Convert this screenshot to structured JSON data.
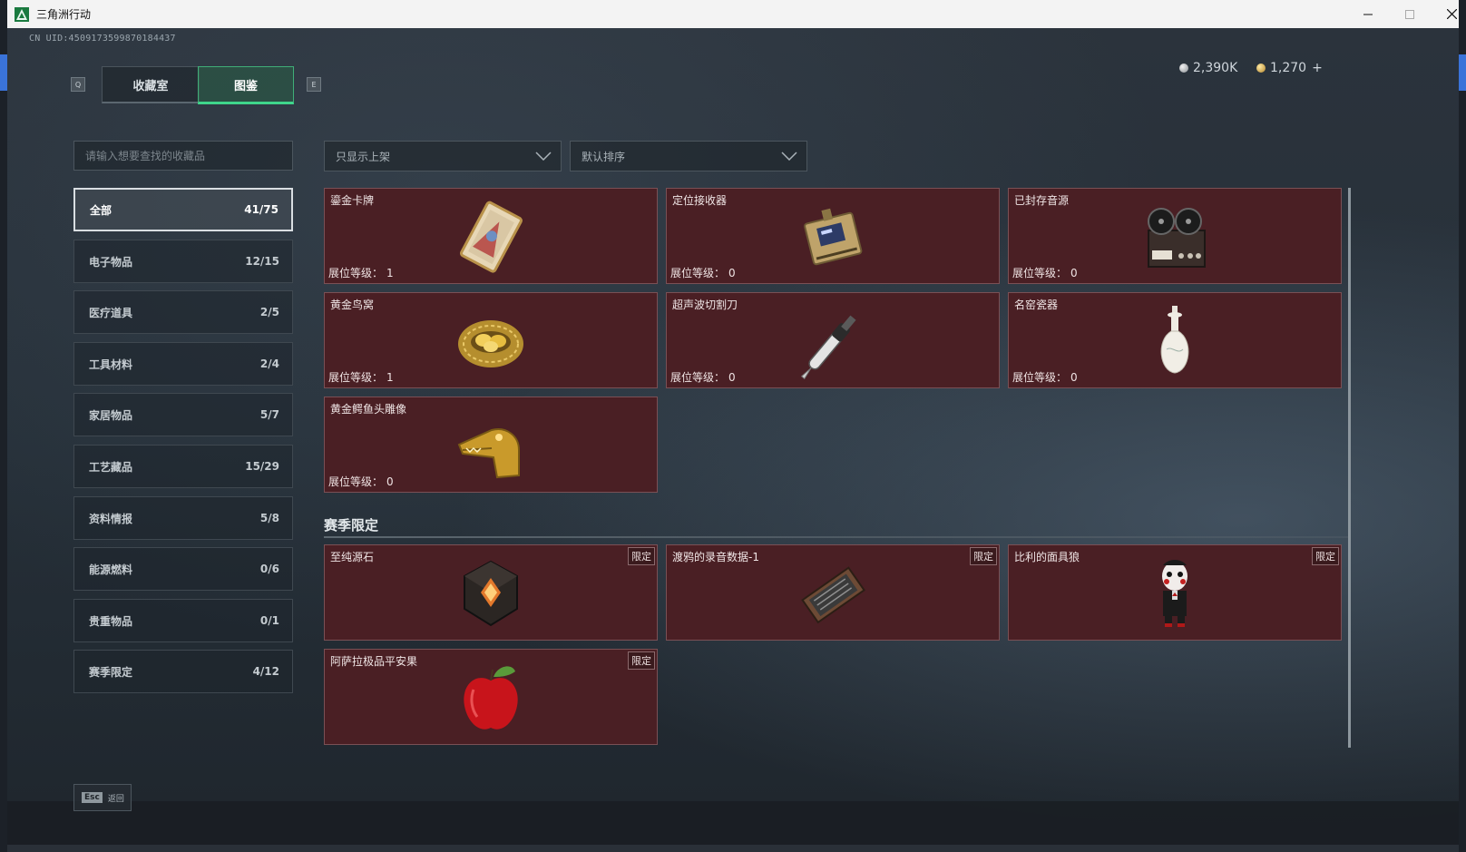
{
  "window": {
    "title": "三角洲行动"
  },
  "header": {
    "uid": "CN UID:4509173599870184437",
    "key_left": "Q",
    "key_right": "E",
    "tabs": [
      {
        "label": "收藏室"
      },
      {
        "label": "图鉴"
      }
    ],
    "active_tab": 1,
    "currency_silver": "2,390K",
    "currency_gold": "1,270",
    "currency_add": "+"
  },
  "search": {
    "placeholder": "请输入想要查找的收藏品"
  },
  "filters": {
    "show_filter": "只显示上架",
    "sort": "默认排序"
  },
  "categories": [
    {
      "label": "全部",
      "count": "41/75"
    },
    {
      "label": "电子物品",
      "count": "12/15"
    },
    {
      "label": "医疗道具",
      "count": "2/5"
    },
    {
      "label": "工具材料",
      "count": "2/4"
    },
    {
      "label": "家居物品",
      "count": "5/7"
    },
    {
      "label": "工艺藏品",
      "count": "15/29"
    },
    {
      "label": "资料情报",
      "count": "5/8"
    },
    {
      "label": "能源燃料",
      "count": "0/6"
    },
    {
      "label": "贵重物品",
      "count": "0/1"
    },
    {
      "label": "赛季限定",
      "count": "4/12"
    }
  ],
  "level_label": "展位等级：",
  "items": [
    {
      "name": "鎏金卡牌",
      "level": "1",
      "icon": "gilded-card-icon"
    },
    {
      "name": "定位接收器",
      "level": "0",
      "icon": "locator-receiver-icon"
    },
    {
      "name": "已封存音源",
      "level": "0",
      "icon": "reel-to-reel-recorder-icon"
    },
    {
      "name": "黄金鸟窝",
      "level": "1",
      "icon": "golden-nest-icon"
    },
    {
      "name": "超声波切割刀",
      "level": "0",
      "icon": "ultrasonic-cutter-icon"
    },
    {
      "name": "名窑瓷器",
      "level": "0",
      "icon": "porcelain-vase-icon"
    },
    {
      "name": "黄金鳄鱼头雕像",
      "level": "0",
      "icon": "golden-crocodile-head-icon"
    }
  ],
  "season_section": {
    "title": "赛季限定",
    "badge": "限定",
    "items": [
      {
        "name": "至纯源石",
        "icon": "pure-originium-icon"
      },
      {
        "name": "渡鸦的录音数据-1",
        "icon": "raven-recording-data-icon"
      },
      {
        "name": "比利的面具狼",
        "icon": "billy-puppet-icon"
      },
      {
        "name": "阿萨拉极品平安果",
        "icon": "red-apple-icon"
      }
    ]
  },
  "footer": {
    "esc_key": "Esc",
    "back_label": "返回"
  },
  "colors": {
    "card_bg": "#4a1f24",
    "accent_green": "#3fd68b"
  }
}
